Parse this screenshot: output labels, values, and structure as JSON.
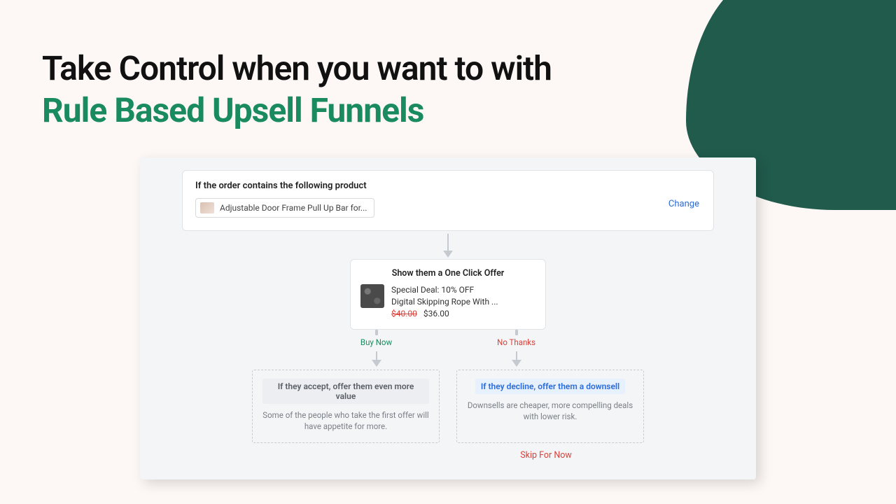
{
  "headline": {
    "line1": "Take Control when you want to with",
    "line2": "Rule Based Upsell Funnels"
  },
  "trigger": {
    "title": "If the order contains the following product",
    "product_name": "Adjustable Door Frame Pull Up Bar for...",
    "change_label": "Change"
  },
  "offer": {
    "title": "Show them a One Click Offer",
    "deal_line": "Special Deal: 10% OFF",
    "product_line": "Digital Skipping Rope With ...",
    "price_old": "$40.00",
    "price_new": "$36.00"
  },
  "branches": {
    "accept_label": "Buy Now",
    "decline_label": "No Thanks"
  },
  "accept_card": {
    "badge": "If they accept, offer them even more value",
    "desc": "Some of the people who take the first offer will have appetite for more."
  },
  "decline_card": {
    "badge": "If they decline, offer them a downsell",
    "desc": "Downsells are cheaper, more compelling deals with lower risk."
  },
  "skip_label": "Skip For Now"
}
